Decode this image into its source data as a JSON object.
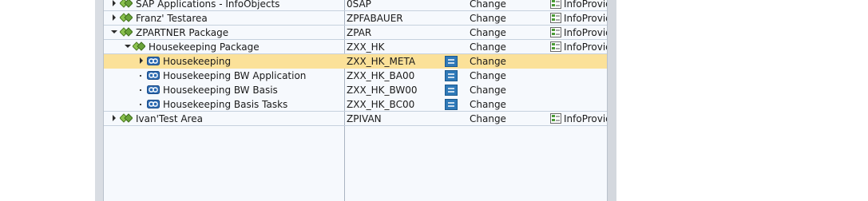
{
  "tree": {
    "rows": [
      {
        "label": "SAP Applications - InfoObjects",
        "tech": "0SAP",
        "action": "Change",
        "provider": "InfoProvid"
      },
      {
        "label": "Franz' Testarea",
        "tech": "ZPFABAUER",
        "action": "Change",
        "provider": "InfoProvid"
      },
      {
        "label": "ZPARTNER Package",
        "tech": "ZPAR",
        "action": "Change",
        "provider": "InfoProvid"
      },
      {
        "label": "Housekeeping Package",
        "tech": "ZXX_HK",
        "action": "Change",
        "provider": "InfoProvid"
      },
      {
        "label": "Housekeeping",
        "tech": "ZXX_HK_META",
        "action": "Change"
      },
      {
        "label": "Housekeeping BW Application",
        "tech": "ZXX_HK_BA00",
        "action": "Change"
      },
      {
        "label": "Housekeeping BW Basis",
        "tech": "ZXX_HK_BW00",
        "action": "Change"
      },
      {
        "label": "Housekeeping Basis Tasks",
        "tech": "ZXX_HK_BC00",
        "action": "Change"
      },
      {
        "label": "Ivan'Test Area",
        "tech": "ZPIVAN",
        "action": "Change",
        "provider": "InfoProvid"
      }
    ]
  },
  "icons": {
    "expand": "triangle-right-icon",
    "collapse": "triangle-down-icon",
    "package": "package-diamond-icon",
    "component": "process-chain-component-icon",
    "document": "documentation-icon",
    "provider": "infoprovider-icon"
  },
  "colors": {
    "selected_row": "#fbe199",
    "tree_background": "#f6f9fd",
    "package_icon": "#6aa33a",
    "component_icon": "#2d6bb3",
    "doc_icon": "#2f79b8"
  }
}
